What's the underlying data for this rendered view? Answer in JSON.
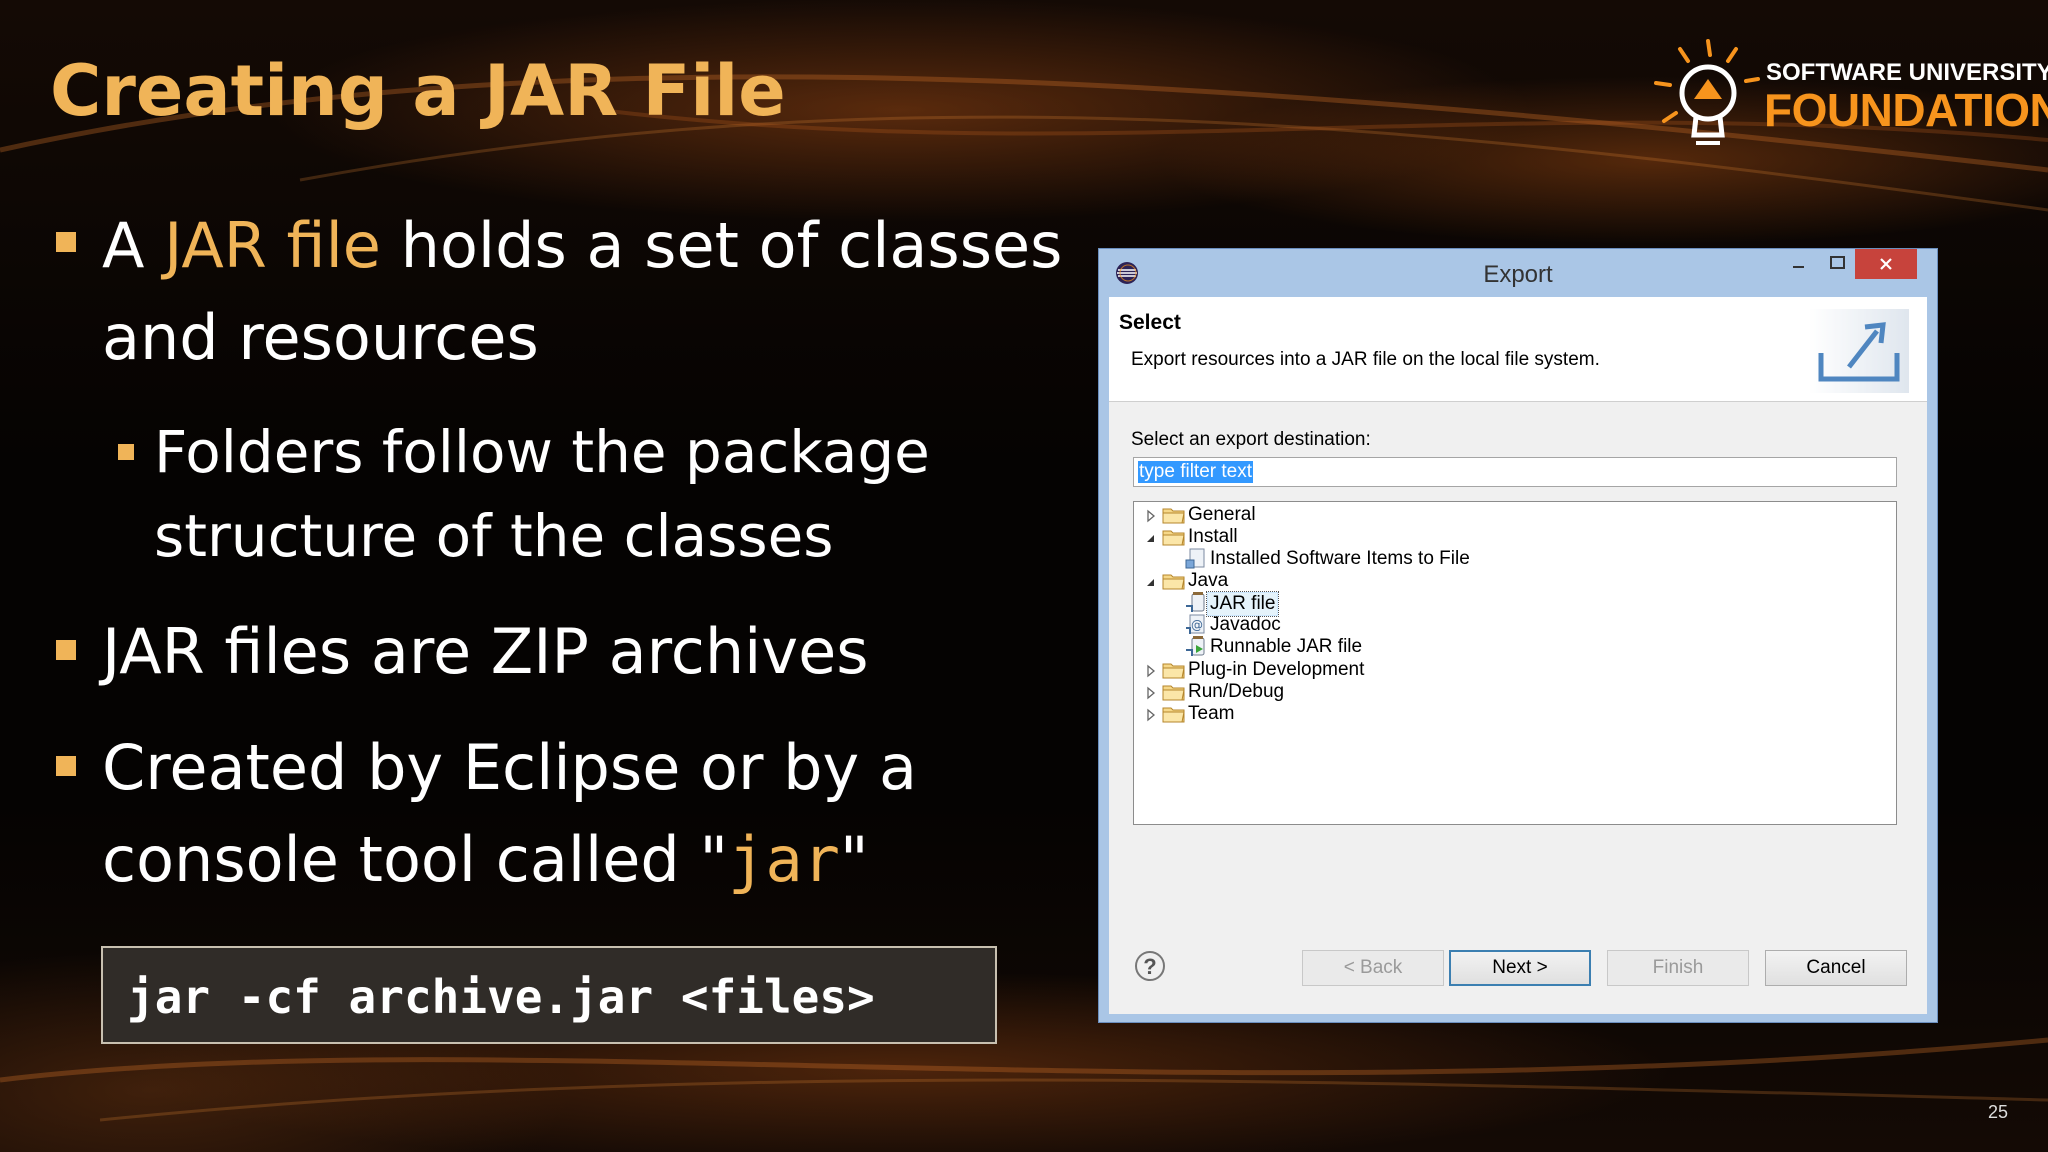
{
  "slide": {
    "title": "Creating a JAR File",
    "page_number": "25"
  },
  "logo": {
    "line1": "SOFTWARE UNIVERSITY",
    "line2": "FOUNDATION"
  },
  "bullets": {
    "b1": {
      "pre": "A ",
      "highlight": "JAR file",
      "post": " holds a set of classes",
      "line2": "and resources"
    },
    "b1_sub": {
      "line1": "Folders follow the package",
      "line2": "structure of the classes"
    },
    "b2": {
      "text": "JAR files are ZIP archives"
    },
    "b3": {
      "line1": "Created by Eclipse or by a",
      "line2_pre": "console tool called \"",
      "line2_code": "jar",
      "line2_post": "\""
    }
  },
  "code": "jar -cf archive.jar <files>",
  "dialog": {
    "title": "Export",
    "header_title": "Select",
    "header_desc": "Export resources into a JAR file on the local file system.",
    "dest_label": "Select an export destination:",
    "filter_value": "type filter text",
    "tree": {
      "general": "General",
      "install": "Install",
      "installed_items": "Installed Software Items to File",
      "java": "Java",
      "jar_file": "JAR file",
      "javadoc": "Javadoc",
      "runnable_jar": "Runnable JAR file",
      "plugin_dev": "Plug-in Development",
      "run_debug": "Run/Debug",
      "team": "Team"
    },
    "buttons": {
      "help": "?",
      "back": "< Back",
      "next": "Next >",
      "finish": "Finish",
      "cancel": "Cancel"
    }
  },
  "colors": {
    "accent": "#f0b458",
    "logo_orange": "#f7941d",
    "close_red": "#c7433c"
  }
}
